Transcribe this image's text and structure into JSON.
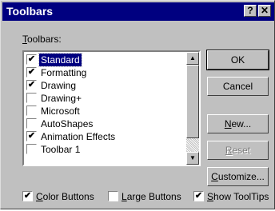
{
  "window": {
    "title": "Toolbars",
    "help_glyph": "?",
    "close_glyph": "✕"
  },
  "toolbars_label": {
    "mnemonic": "T",
    "rest": "oolbars:"
  },
  "toolbars": [
    {
      "label": "Standard",
      "checked": true,
      "selected": true
    },
    {
      "label": "Formatting",
      "checked": true,
      "selected": false
    },
    {
      "label": "Drawing",
      "checked": true,
      "selected": false
    },
    {
      "label": "Drawing+",
      "checked": false,
      "selected": false
    },
    {
      "label": "Microsoft",
      "checked": false,
      "selected": false
    },
    {
      "label": "AutoShapes",
      "checked": false,
      "selected": false
    },
    {
      "label": "Animation Effects",
      "checked": true,
      "selected": false
    },
    {
      "label": "Toolbar 1",
      "checked": false,
      "selected": false
    }
  ],
  "buttons": {
    "ok": "OK",
    "cancel": "Cancel",
    "new": {
      "mnemonic": "N",
      "rest": "ew..."
    },
    "reset": {
      "mnemonic": "R",
      "rest": "eset"
    },
    "customize": {
      "mnemonic": "C",
      "rest": "ustomize..."
    }
  },
  "options": {
    "color_buttons": {
      "mnemonic": "C",
      "rest": "olor Buttons",
      "checked": true
    },
    "large_buttons": {
      "mnemonic": "L",
      "rest": "arge Buttons",
      "checked": false
    },
    "show_tooltips": {
      "mnemonic": "S",
      "rest": "how ToolTips",
      "checked": true
    }
  },
  "check_glyph": "✔",
  "scroll_up_glyph": "▲",
  "scroll_down_glyph": "▼",
  "colors": {
    "titlebar": "#000080",
    "face": "#c0c0c0",
    "selection": "#000080"
  }
}
